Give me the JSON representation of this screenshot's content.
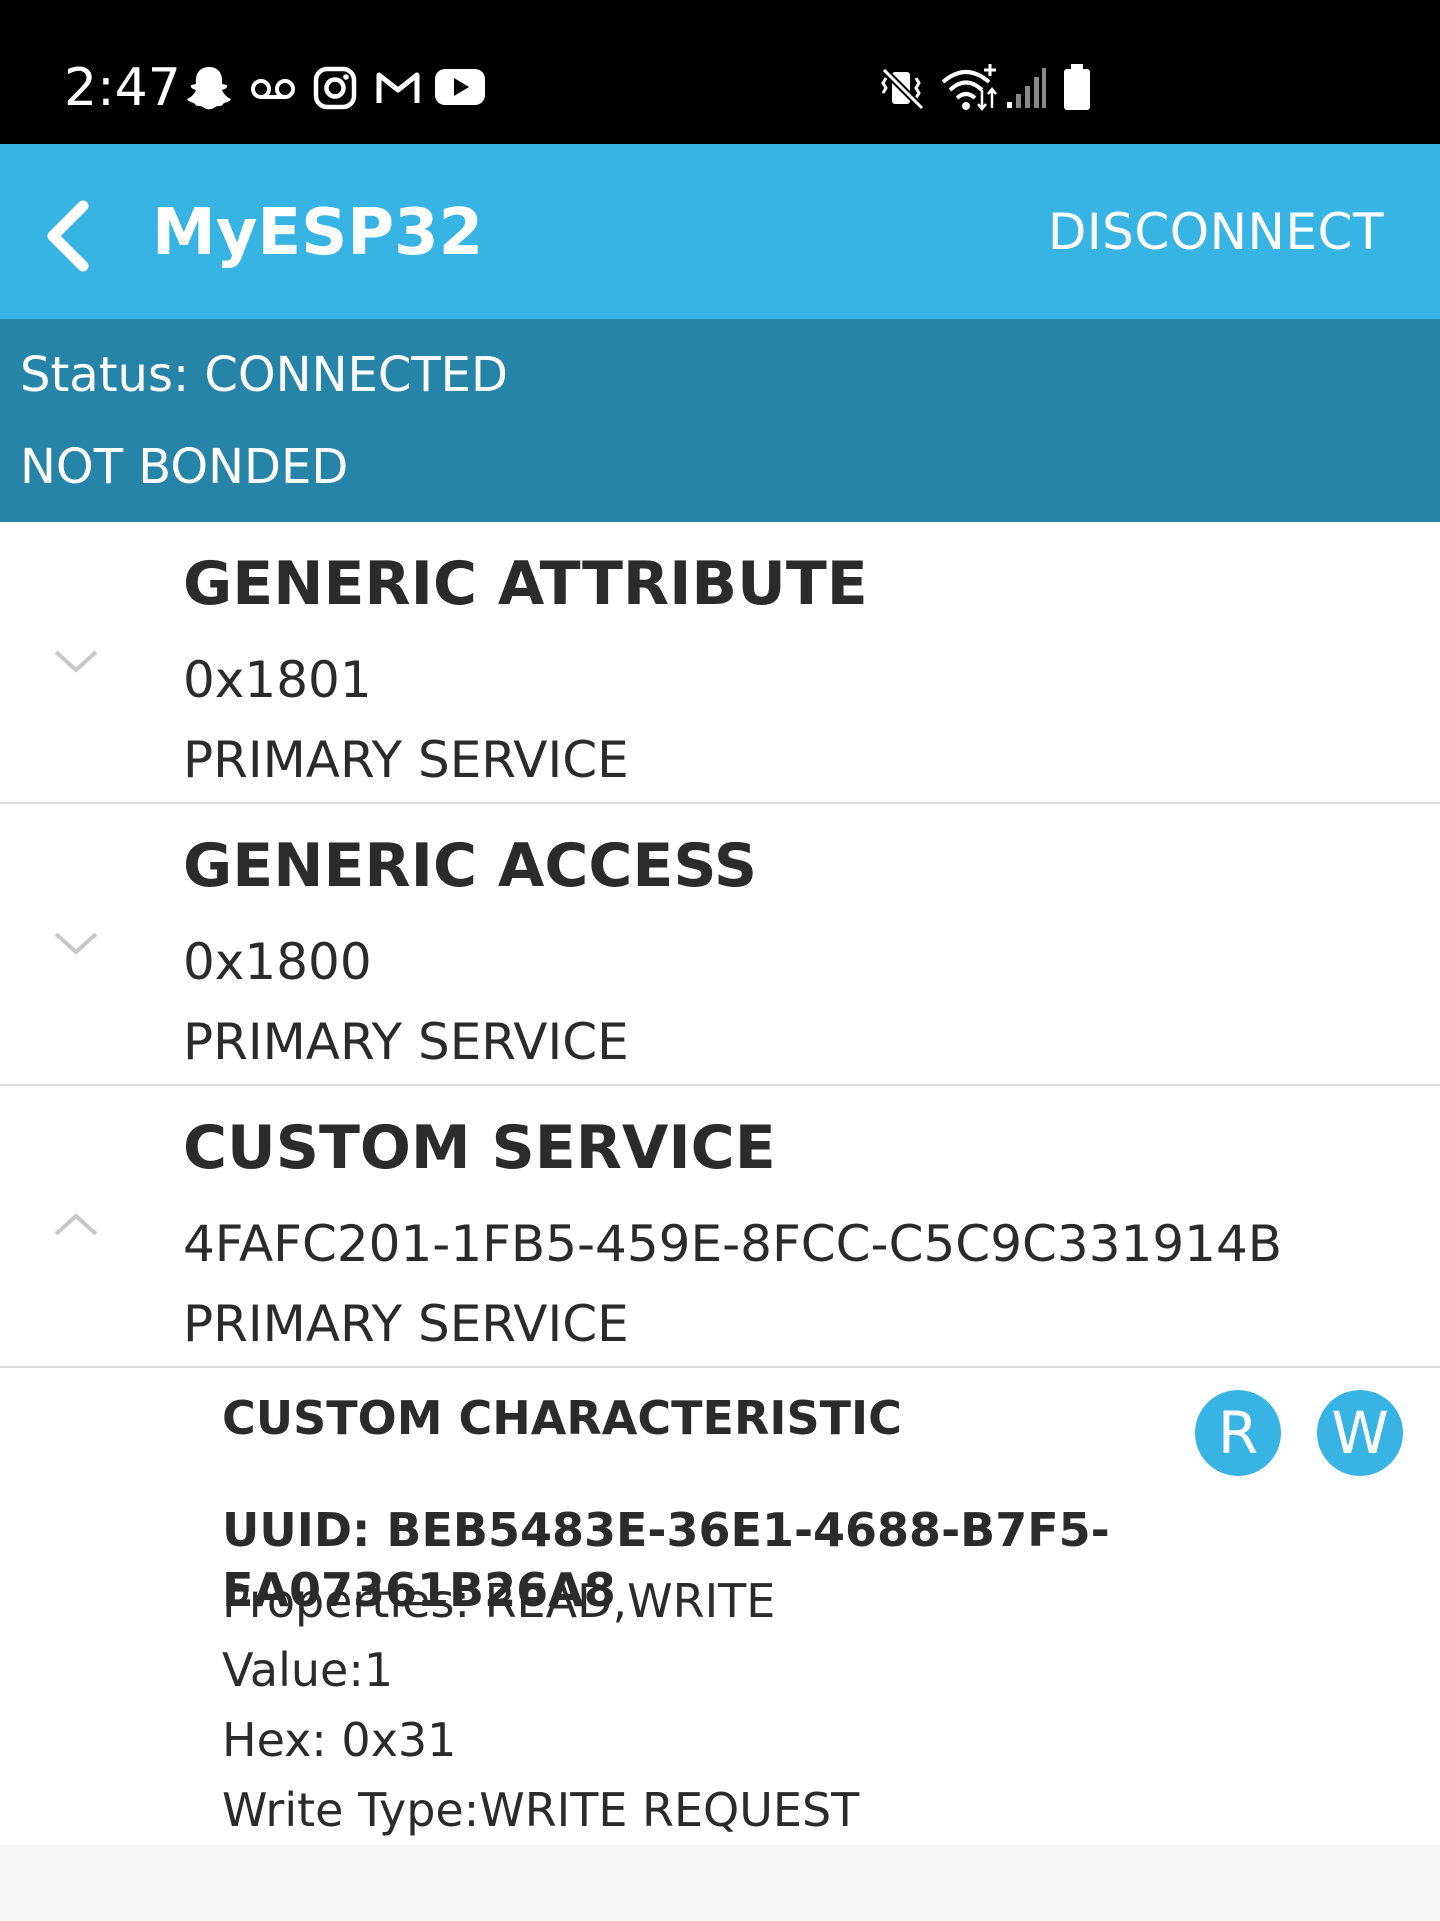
{
  "status_bar": {
    "time": "2:47",
    "left_icons": [
      "snapchat-icon",
      "voicemail-icon",
      "instagram-icon",
      "gmail-icon",
      "youtube-icon"
    ],
    "right_icons": [
      "vibrate-mute-icon",
      "wifi-icon",
      "cell-signal-icon",
      "battery-icon"
    ]
  },
  "app_bar": {
    "title": "MyESP32",
    "action": "DISCONNECT",
    "color": "#37b4e3"
  },
  "connection": {
    "status": "Status: CONNECTED",
    "bond": "NOT BONDED",
    "color": "#2584a8"
  },
  "services": [
    {
      "name": "GENERIC ATTRIBUTE",
      "uuid": "0x1801",
      "type": "PRIMARY SERVICE",
      "expanded": false
    },
    {
      "name": "GENERIC ACCESS",
      "uuid": "0x1800",
      "type": "PRIMARY SERVICE",
      "expanded": false
    },
    {
      "name": "CUSTOM SERVICE",
      "uuid": "4FAFC201-1FB5-459E-8FCC-C5C9C331914B",
      "type": "PRIMARY SERVICE",
      "expanded": true
    }
  ],
  "characteristic": {
    "name": "CUSTOM CHARACTERISTIC",
    "read_badge": "R",
    "write_badge": "W",
    "uuid": "UUID: BEB5483E-36E1-4688-B7F5-EA07361B26A8",
    "properties": "Properties: READ,WRITE",
    "value": "Value:1",
    "hex": "Hex: 0x31",
    "write_type": "Write Type:WRITE REQUEST"
  }
}
